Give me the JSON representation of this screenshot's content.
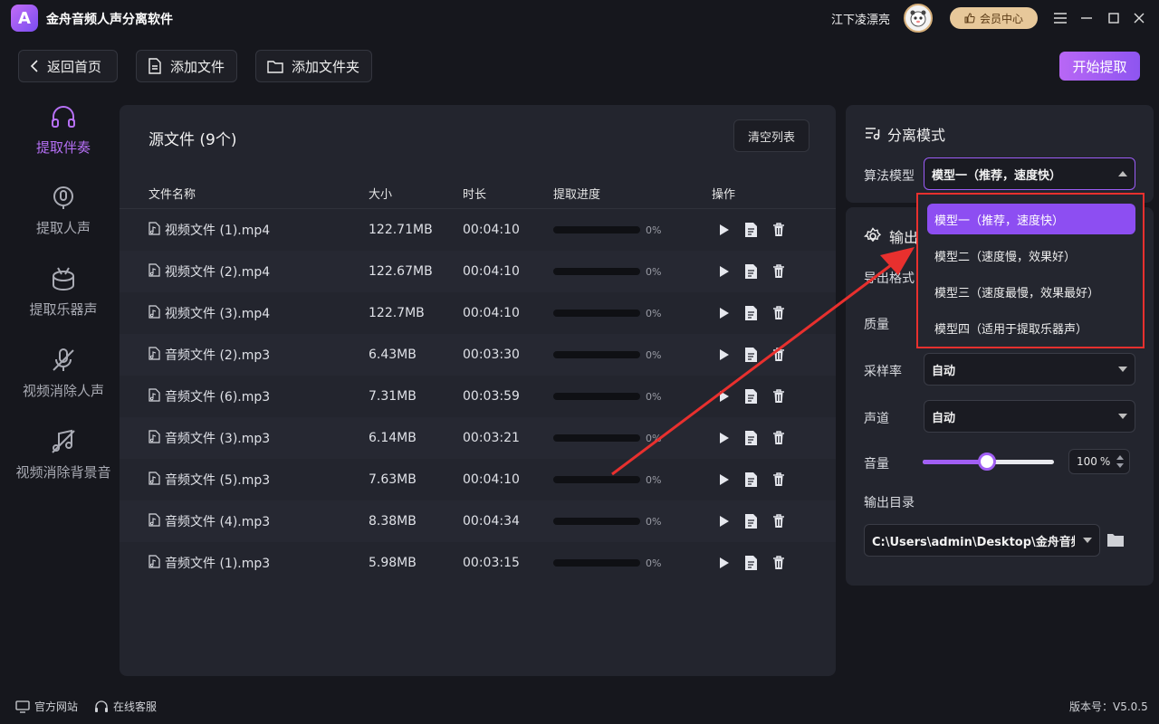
{
  "app": {
    "logo_letter": "A",
    "title": "金舟音频人声分离软件"
  },
  "user": {
    "name": "江下凌漂亮",
    "vip_label": "会员中心"
  },
  "toolbar": {
    "back_label": "返回首页",
    "add_file_label": "添加文件",
    "add_folder_label": "添加文件夹",
    "start_label": "开始提取"
  },
  "sidebar": {
    "items": [
      {
        "label": "提取伴奏",
        "icon": "headphones-icon",
        "active": true
      },
      {
        "label": "提取人声",
        "icon": "vocal-icon",
        "active": false
      },
      {
        "label": "提取乐器声",
        "icon": "drum-icon",
        "active": false
      },
      {
        "label": "视频消除人声",
        "icon": "mic-off-icon",
        "active": false
      },
      {
        "label": "视频消除背景音",
        "icon": "music-off-icon",
        "active": false
      }
    ]
  },
  "files": {
    "title": "源文件 (9个)",
    "clear_label": "清空列表",
    "columns": {
      "name": "文件名称",
      "size": "大小",
      "duration": "时长",
      "progress": "提取进度",
      "ops": "操作"
    },
    "rows": [
      {
        "name": "视频文件 (1).mp4",
        "size": "122.71MB",
        "duration": "00:04:10",
        "progress": 0,
        "progress_label": "0%"
      },
      {
        "name": "视频文件 (2).mp4",
        "size": "122.67MB",
        "duration": "00:04:10",
        "progress": 0,
        "progress_label": "0%"
      },
      {
        "name": "视频文件 (3).mp4",
        "size": "122.7MB",
        "duration": "00:04:10",
        "progress": 0,
        "progress_label": "0%"
      },
      {
        "name": "音频文件 (2).mp3",
        "size": "6.43MB",
        "duration": "00:03:30",
        "progress": 0,
        "progress_label": "0%"
      },
      {
        "name": "音频文件 (6).mp3",
        "size": "7.31MB",
        "duration": "00:03:59",
        "progress": 0,
        "progress_label": "0%"
      },
      {
        "name": "音频文件 (3).mp3",
        "size": "6.14MB",
        "duration": "00:03:21",
        "progress": 0,
        "progress_label": "0%"
      },
      {
        "name": "音频文件 (5).mp3",
        "size": "7.63MB",
        "duration": "00:04:10",
        "progress": 0,
        "progress_label": "0%"
      },
      {
        "name": "音频文件 (4).mp3",
        "size": "8.38MB",
        "duration": "00:04:34",
        "progress": 0,
        "progress_label": "0%"
      },
      {
        "name": "音频文件 (1).mp3",
        "size": "5.98MB",
        "duration": "00:03:15",
        "progress": 0,
        "progress_label": "0%"
      }
    ]
  },
  "mode": {
    "title": "分离模式",
    "model_label": "算法模型",
    "model_value": "模型一（推荐，速度快）",
    "options": [
      "模型一（推荐，速度快）",
      "模型二（速度慢，效果好）",
      "模型三（速度最慢，效果最好）",
      "模型四（适用于提取乐器声）"
    ],
    "selected_index": 0
  },
  "output": {
    "title_partial": "输出",
    "format_label_partial": "导出格式",
    "quality_label": "质量",
    "sample_rate_label": "采样率",
    "sample_rate_value": "自动",
    "channel_label": "声道",
    "channel_value": "自动",
    "volume_label": "音量",
    "volume_value": "100",
    "volume_unit": "%",
    "volume_slider_fraction": 0.49,
    "dir_label": "输出目录",
    "dir_value": "C:\\Users\\admin\\Desktop\\金舟音频"
  },
  "footer": {
    "website": "官方网站",
    "support": "在线客服",
    "version": "版本号：V5.0.5"
  },
  "colors": {
    "accent": "#a15ff4",
    "annotation": "#e8302e"
  }
}
